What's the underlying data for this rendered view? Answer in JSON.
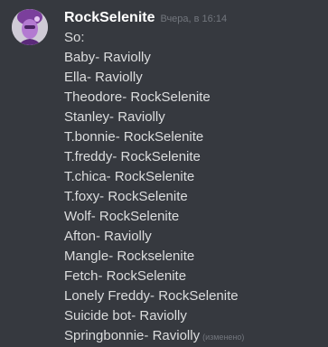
{
  "message": {
    "author": "RockSelenite",
    "timestamp": "Вчера, в 16:14",
    "lines": [
      "So:",
      "Baby- Raviolly",
      "Ella- Raviolly",
      "Theodore- RockSelenite",
      "Stanley- Raviolly",
      "T.bonnie- RockSelenite",
      "T.freddy- RockSelenite",
      "T.chica- RockSelenite",
      "T.foxy- RockSelenite",
      "Wolf- RockSelenite",
      "Afton- Raviolly",
      "Mangle- Rockselenite",
      "Fetch- RockSelenite",
      "Lonely Freddy- RockSelenite",
      "Suicide bot- Raviolly",
      "Springbonnie- Raviolly"
    ],
    "edited_label": "(изменено)"
  },
  "colors": {
    "background": "#36393f",
    "username": "#ffffff",
    "text": "#dcddde",
    "muted": "#72767d",
    "avatar_accent": "#9b4fc0"
  }
}
